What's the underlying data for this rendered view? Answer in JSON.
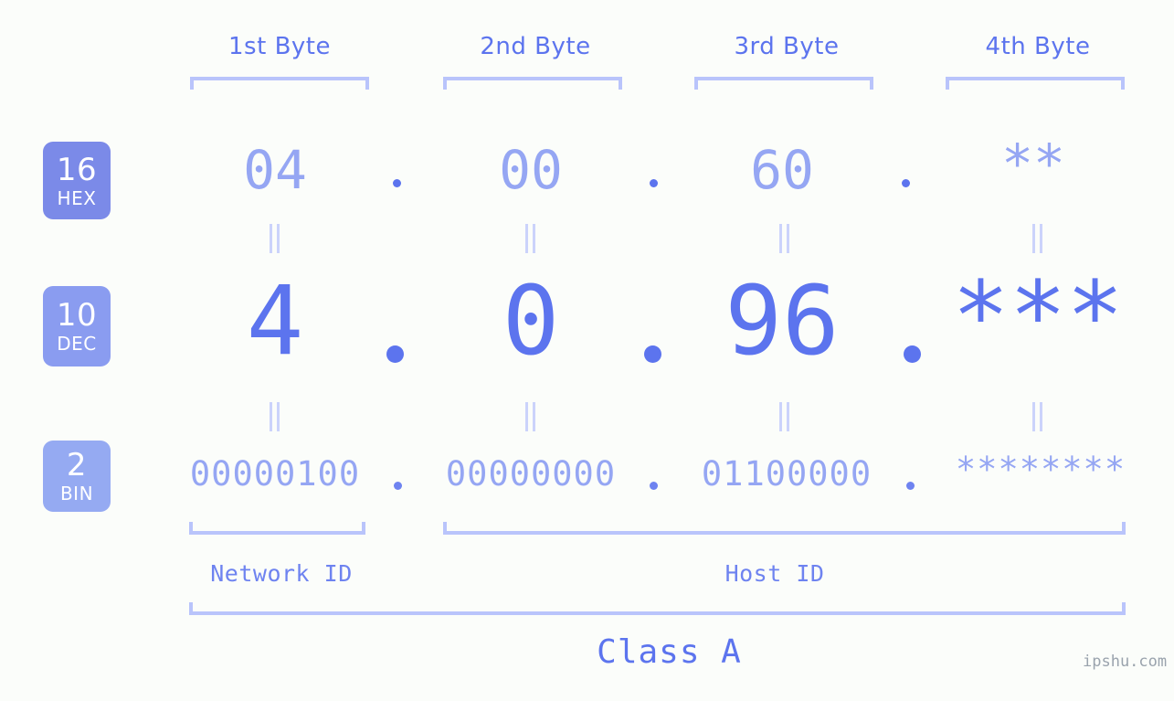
{
  "background_color": "#fbfdfa",
  "colors": {
    "accent_strong": "#5c74ee",
    "accent_mid": "#7b8ae8",
    "accent_light": "#95a6f3",
    "bracket": "#b9c4fb",
    "equals": "#cbd3fb",
    "watermark": "#9aa3ad"
  },
  "byte_headers": [
    {
      "label": "1st Byte"
    },
    {
      "label": "2nd Byte"
    },
    {
      "label": "3rd Byte"
    },
    {
      "label": "4th Byte"
    }
  ],
  "rows": [
    {
      "base_number": "16",
      "base_name": "HEX",
      "badge_color": "#7b8ae8",
      "values": [
        "04",
        "00",
        "60",
        "**"
      ],
      "separators": [
        ".",
        ".",
        "."
      ]
    },
    {
      "base_number": "10",
      "base_name": "DEC",
      "badge_color": "#8a9cf0",
      "values": [
        "4",
        "0",
        "96",
        "***"
      ],
      "separators": [
        ".",
        ".",
        "."
      ]
    },
    {
      "base_number": "2",
      "base_name": "BIN",
      "badge_color": "#95aaf2",
      "values": [
        "00000100",
        "00000000",
        "01100000",
        "********"
      ],
      "separators": [
        ".",
        ".",
        "."
      ]
    }
  ],
  "segments": {
    "network_id": "Network ID",
    "host_id": "Host ID",
    "class": "Class A"
  },
  "watermark": "ipshu.com"
}
